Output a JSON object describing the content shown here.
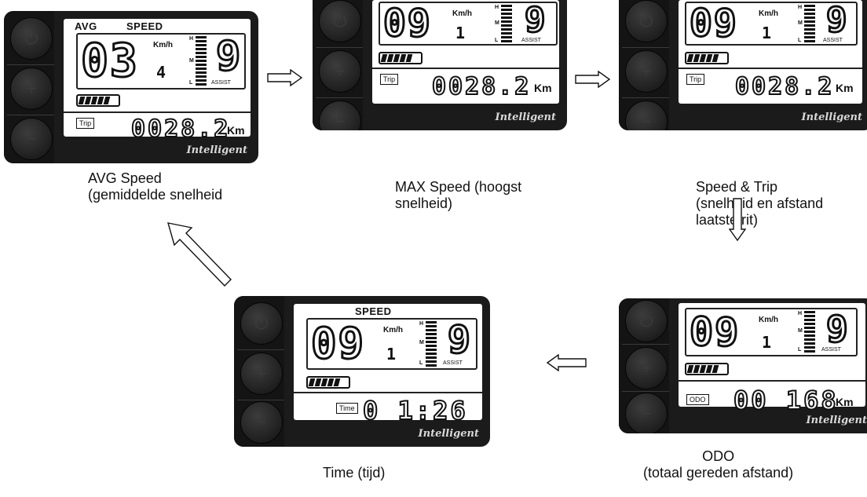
{
  "brand": "Intelligent",
  "units": {
    "speed": "Km/h",
    "distance": "Km",
    "assist": "ASSIST"
  },
  "level_letters": {
    "high": "H",
    "mid": "M",
    "low": "L"
  },
  "button_glyphs": {
    "power": "⏻",
    "plus": "+",
    "minus": "−"
  },
  "panels": {
    "avg": {
      "mode_label": "AVG",
      "speed_label": "SPEED",
      "speed_int": "03",
      "speed_dec": "4",
      "assist": "9",
      "tag": "Trip",
      "counter": "0028.2",
      "caption": "AVG Speed\n(gemiddelde snelheid"
    },
    "max": {
      "speed_int": "09",
      "speed_dec": "1",
      "assist": "9",
      "tag": "Trip",
      "counter": "0028.2",
      "caption": "MAX Speed (hoogst\nsnelheid)"
    },
    "trip": {
      "speed_int": "09",
      "speed_dec": "1",
      "assist": "9",
      "tag": "Trip",
      "counter": "0028.2",
      "caption": "Speed & Trip\n(snelheid en afstand\nlaatste rit)"
    },
    "time": {
      "speed_label": "SPEED",
      "speed_int": "09",
      "speed_dec": "1",
      "assist": "9",
      "tag": "Time",
      "counter": "0 1:26",
      "caption": "Time (tijd)"
    },
    "odo": {
      "speed_int": "09",
      "speed_dec": "1",
      "assist": "9",
      "tag": "ODO",
      "counter": "00 168",
      "caption": "ODO\n(totaal gereden afstand)"
    }
  }
}
